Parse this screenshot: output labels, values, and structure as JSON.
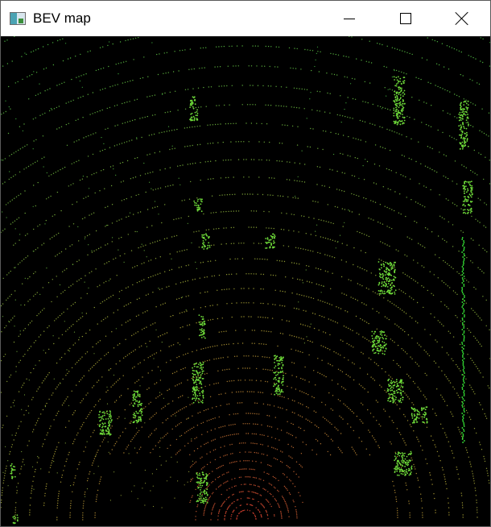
{
  "window": {
    "title": "BEV map",
    "icon": "opencv-window-icon",
    "controls": [
      "minimize-icon",
      "maximize-icon",
      "close-icon"
    ]
  },
  "view": {
    "type": "bird's-eye-view lidar point cloud",
    "background": "#000000",
    "colors": {
      "near_points": "#c0392b",
      "mid_points": "#9a8f2e",
      "far_points": "#3fae3f",
      "objects": "#6fdc3a",
      "wall": "#3cff3c"
    }
  }
}
